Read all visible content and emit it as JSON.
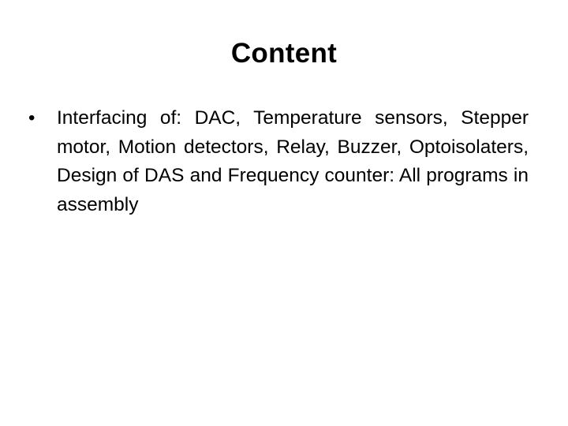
{
  "slide": {
    "title": "Content",
    "bullets": [
      {
        "marker": "•",
        "text": "Interfacing of: DAC, Temperature sensors, Stepper motor, Motion detectors, Relay, Buzzer, Optoisolaters, Design of DAS and Frequency counter: All programs in assembly"
      }
    ]
  }
}
